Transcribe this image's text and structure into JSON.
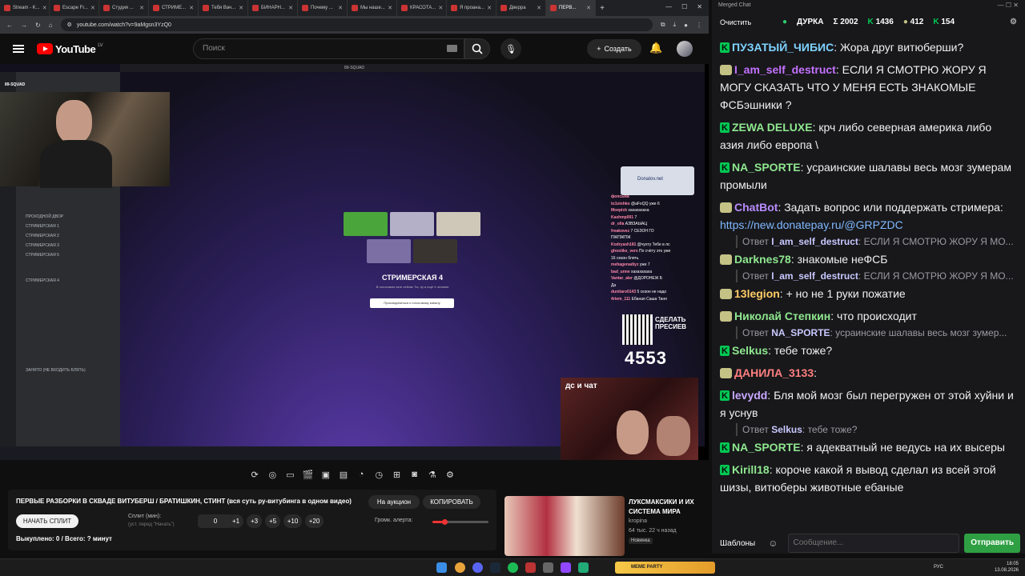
{
  "browser": {
    "tabs": [
      {
        "label": "Stream - K...",
        "active": false
      },
      {
        "label": "Escape Fr...",
        "active": false
      },
      {
        "label": "Студия ...",
        "active": false
      },
      {
        "label": "СТРИМЕ...",
        "active": false
      },
      {
        "label": "Тебя Вач...",
        "active": false
      },
      {
        "label": "БИНАРН...",
        "active": false
      },
      {
        "label": "Почему ...",
        "active": false
      },
      {
        "label": "Мы наше...",
        "active": false
      },
      {
        "label": "КРАСОТА...",
        "active": false
      },
      {
        "label": "Я проана...",
        "active": false
      },
      {
        "label": "Дверра",
        "active": false
      },
      {
        "label": "ПЕРВ...",
        "active": true
      }
    ],
    "url": "youtube.com/watch?v=9aMgsn3YzQ0"
  },
  "youtube": {
    "logo_text": "YouTube",
    "region": "LV",
    "search_placeholder": "Поиск",
    "create_label": "Создать"
  },
  "video": {
    "top_label": "89-SQUAD",
    "discord_server": "89-SQUAD",
    "discord_channels": [
      "ПРОХОДНОЙ ДВОР",
      "СТРИМЕРСКАЯ 1",
      "СТРИМЕРСКАЯ 2",
      "СТРИМЕРСКАЯ 3",
      "СТРИМЕРСКАЯ 5",
      "СТРИМЕРСКАЯ 4",
      "ЗАНЯТО (НЕ ВХОДИТЬ БЛЯТЬ)"
    ],
    "channel_title": "СТРИМЕРСКАЯ 4",
    "channel_sub": "В голосовом чате сейчас Ты, ну и ещё 4 человек",
    "join_label": "Присоединиться к голосовому каналу",
    "donation_site": "Donatov.net",
    "mini_chat": [
      {
        "u": "фопсьжа",
        "t": ""
      },
      {
        "u": "to1oishko",
        "t": "@aFoQQ уже 6"
      },
      {
        "u": "Moepick",
        "t": "хахахахаха"
      },
      {
        "u": "Kashmp001",
        "t": "7"
      },
      {
        "u": "dr_olla",
        "t": "АЗВЗАЫАЦ"
      },
      {
        "u": "freakovez",
        "t": "7 СЕЗОН ГО"
      },
      {
        "u": "",
        "t": "ПЖПЖПЖ"
      },
      {
        "u": "Kodryash181",
        "t": "@чухту Тебе в лс"
      },
      {
        "u": "ghostiks_vers",
        "t": "По счёту это уже"
      },
      {
        "u": "",
        "t": "16 сезон блять"
      },
      {
        "u": "mehagenadiyz",
        "t": "уже 7"
      },
      {
        "u": "bad_unne",
        "t": "хахахахаха"
      },
      {
        "u": "Vantar_aler",
        "t": "@ДОРОНЕЖ Б"
      },
      {
        "u": "",
        "t": "Да"
      },
      {
        "u": "dunitaro0143",
        "t": "5 сезон не надо"
      },
      {
        "u": "4rtem_111",
        "t": "Ебаная Саша Таня"
      }
    ],
    "qr_text": "СДЕЛАТЬ ПРЕСИЕВ",
    "counter": "4553",
    "cam_label": "дс и чат"
  },
  "panel": {
    "title": "ПЕРВЫЕ РАЗБОРКИ В СКВАДЕ ВИТУБЕРШ / БРАТИШКИН, СТИНТ (вся суть ру-витубинга в одном видео)",
    "auction_label": "На аукцион",
    "copy_label": "КОПИРОВАТЬ",
    "start_label": "НАЧАТЬ СПЛИТ",
    "split_label": "Сплит (мин):",
    "split_hint": "(уст. перед \"Начать\")",
    "split_value": "0",
    "steps": [
      "+1",
      "+3",
      "+5",
      "+10",
      "+20"
    ],
    "volume_label": "Громк. алерта:",
    "volume_level": 0.22,
    "bought": "Выкуплено: 0 / Всего: ? минут"
  },
  "recommendation": {
    "title": "ЛУКСМАКСИКИ И ИХ СИСТЕМА МИРА",
    "channel": "kropina",
    "meta": "64 тыс.  22 ч назад",
    "badge": "Новинка"
  },
  "chat": {
    "window_title": "Merged Chat",
    "clear_label": "Очистить",
    "streamer": "ДУРКА",
    "stat_total": "Σ 2002",
    "stat_twitch": "1436",
    "stat_other": "412",
    "stat_third": "154",
    "messages": [
      {
        "src": "twitch",
        "user": "ПУЗАТЫЙ_ЧИБИС",
        "color": "#7fd2ff",
        "text": "Жора друг витюберши?"
      },
      {
        "src": "vk",
        "user": "I_am_self_destruct",
        "color": "#c471ff",
        "text": "ЕСЛИ Я СМОТРЮ ЖОРУ Я МОГУ СКАЗАТЬ ЧТО У МЕНЯ ЕСТЬ ЗНАКОМЫЕ ФСБэшники ?"
      },
      {
        "src": "twitch",
        "user": "ZEWA DELUXE",
        "color": "#8fe88f",
        "text": "крч либо северная америка либо азия либо европа \\"
      },
      {
        "src": "twitch",
        "user": "NA_SPORTE",
        "color": "#8fe88f",
        "text": "усраинские шалавы весь мозг зумерам промыли"
      },
      {
        "src": "vk",
        "user": "ChatBot",
        "color": "#b98cff",
        "text": "Задать вопрос или поддержать стримера: ",
        "link": "https://new.donatepay.ru/@GRPZDC"
      },
      {
        "src": "reply",
        "label": "Ответ",
        "user": "I_am_self_destruct",
        "text": "ЕСЛИ Я СМОТРЮ ЖОРУ Я МО..."
      },
      {
        "src": "vk",
        "user": "Darknes78",
        "color": "#8fe88f",
        "text": "знакомые неФСБ"
      },
      {
        "src": "reply",
        "label": "Ответ",
        "user": "I_am_self_destruct",
        "text": "ЕСЛИ Я СМОТРЮ ЖОРУ Я МО..."
      },
      {
        "src": "vk",
        "user": "13legion",
        "color": "#ffcc66",
        "text": "+  но не 1 руки пожатие"
      },
      {
        "src": "vk",
        "user": "Николай Степкин",
        "color": "#8fe88f",
        "text": "что происходит"
      },
      {
        "src": "reply",
        "label": "Ответ",
        "user": "NA_SPORTE",
        "text": "усраинские шалавы весь мозг зумер..."
      },
      {
        "src": "twitch",
        "user": "Selkus",
        "color": "#8fe88f",
        "text": "тебе тоже?"
      },
      {
        "src": "vk",
        "user": "ДАНИЛА_3133",
        "color": "#ff7f7f",
        "text": ""
      },
      {
        "src": "twitch",
        "user": "levydd",
        "color": "#c8a8ff",
        "text": "Бля мой мозг был перегружен от этой хуйни и я уснув"
      },
      {
        "src": "reply",
        "label": "Ответ",
        "user": "Selkus",
        "text": "тебе тоже?"
      },
      {
        "src": "twitch",
        "user": "NA_SPORTE",
        "color": "#8fe88f",
        "text": "я адекватный не ведусь на их высеры"
      },
      {
        "src": "twitch",
        "user": "Kirill18",
        "color": "#8fe88f",
        "text": "короче какой я вывод сделал из всей этой шизы, витюберы животные ебаные"
      }
    ],
    "templates_label": "Шаблоны",
    "input_placeholder": "Сообщение...",
    "send_label": "Отправить"
  },
  "taskbar": {
    "meme_label": "MEME PARTY",
    "lang": "РУС",
    "time": "18:05",
    "date": "13.08.2026"
  }
}
